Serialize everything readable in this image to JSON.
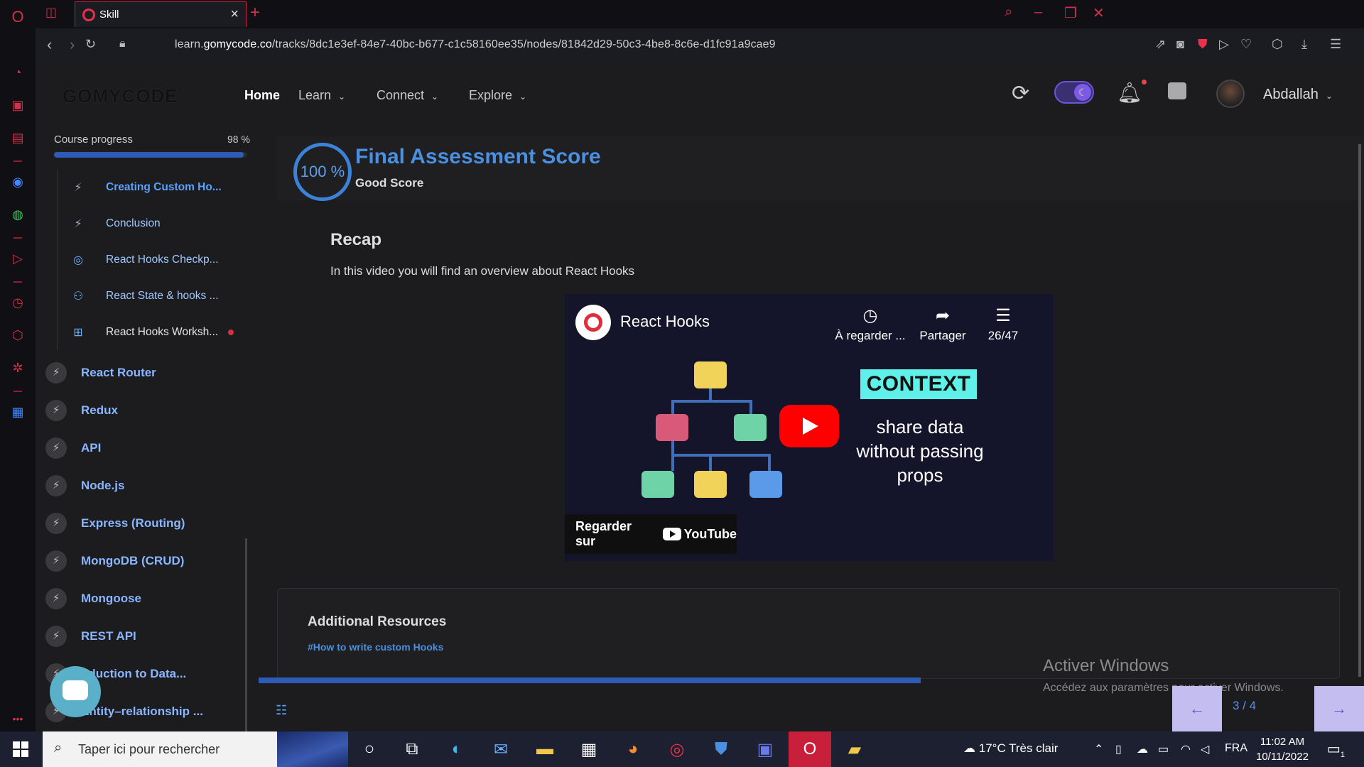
{
  "browser": {
    "tab_title": "Skill",
    "url_prefix": "learn.",
    "url_domain": "gomycode.co",
    "url_path": "/tracks/8dc1e3ef-84e7-40bc-b677-c1c58160ee35/nodes/81842d29-50c3-4be8-8c6e-d1fc91a9cae9"
  },
  "header": {
    "logo": "GOMYCODE",
    "nav": [
      {
        "label": "Home"
      },
      {
        "label": "Learn"
      },
      {
        "label": "Connect"
      },
      {
        "label": "Explore"
      }
    ],
    "username": "Abdallah"
  },
  "sidebar": {
    "progress_label": "Course progress",
    "progress_value": "98 %",
    "progress_fraction": 0.98,
    "sub_items": [
      {
        "label": "Creating Custom Ho...",
        "icon": "bolt-icon"
      },
      {
        "label": "Conclusion",
        "icon": "bolt-icon"
      },
      {
        "label": "React Hooks Checkp...",
        "icon": "target-icon"
      },
      {
        "label": "React State & hooks ...",
        "icon": "people-icon"
      },
      {
        "label": "React Hooks Worksh...",
        "icon": "workshop-icon"
      }
    ],
    "modules": [
      {
        "label": "React Router"
      },
      {
        "label": "Redux"
      },
      {
        "label": "API"
      },
      {
        "label": "Node.js"
      },
      {
        "label": "Express (Routing)"
      },
      {
        "label": "MongoDB (CRUD)"
      },
      {
        "label": "Mongoose"
      },
      {
        "label": "REST API"
      },
      {
        "label": "oduction to Data..."
      },
      {
        "label": "Entity–relationship ..."
      }
    ]
  },
  "score": {
    "value": "100 %",
    "title": "Final Assessment Score",
    "subtitle": "Good Score"
  },
  "recap": {
    "title": "Recap",
    "description": "In this video you will find an overview about React Hooks"
  },
  "video": {
    "title": "React Hooks",
    "actions": [
      {
        "label": "À regarder ...",
        "icon": "clock-icon"
      },
      {
        "label": "Partager",
        "icon": "share-icon"
      },
      {
        "label": "26/47",
        "icon": "playlist-icon"
      }
    ],
    "context_tag": "CONTEXT",
    "context_text": "share data without passing props",
    "watch_on": "Regarder sur",
    "watch_brand": "YouTube"
  },
  "resources": {
    "title": "Additional Resources",
    "link": "#How to write custom Hooks"
  },
  "watermark": {
    "line1": "Activer Windows",
    "line2": "Accédez aux paramètres pour activer Windows."
  },
  "pager": {
    "count": "3 / 4"
  },
  "taskbar": {
    "search_placeholder": "Taper ici pour rechercher",
    "weather": "17°C  Très clair",
    "lang": "FRA",
    "time": "11:02 AM",
    "date": "10/11/2022",
    "notifications": "1"
  },
  "colors": {
    "accent_blue": "#4a8fe0",
    "opera_red": "#d0324b",
    "context_cyan": "#5ff0ea",
    "youtube_red": "#ff0000"
  }
}
